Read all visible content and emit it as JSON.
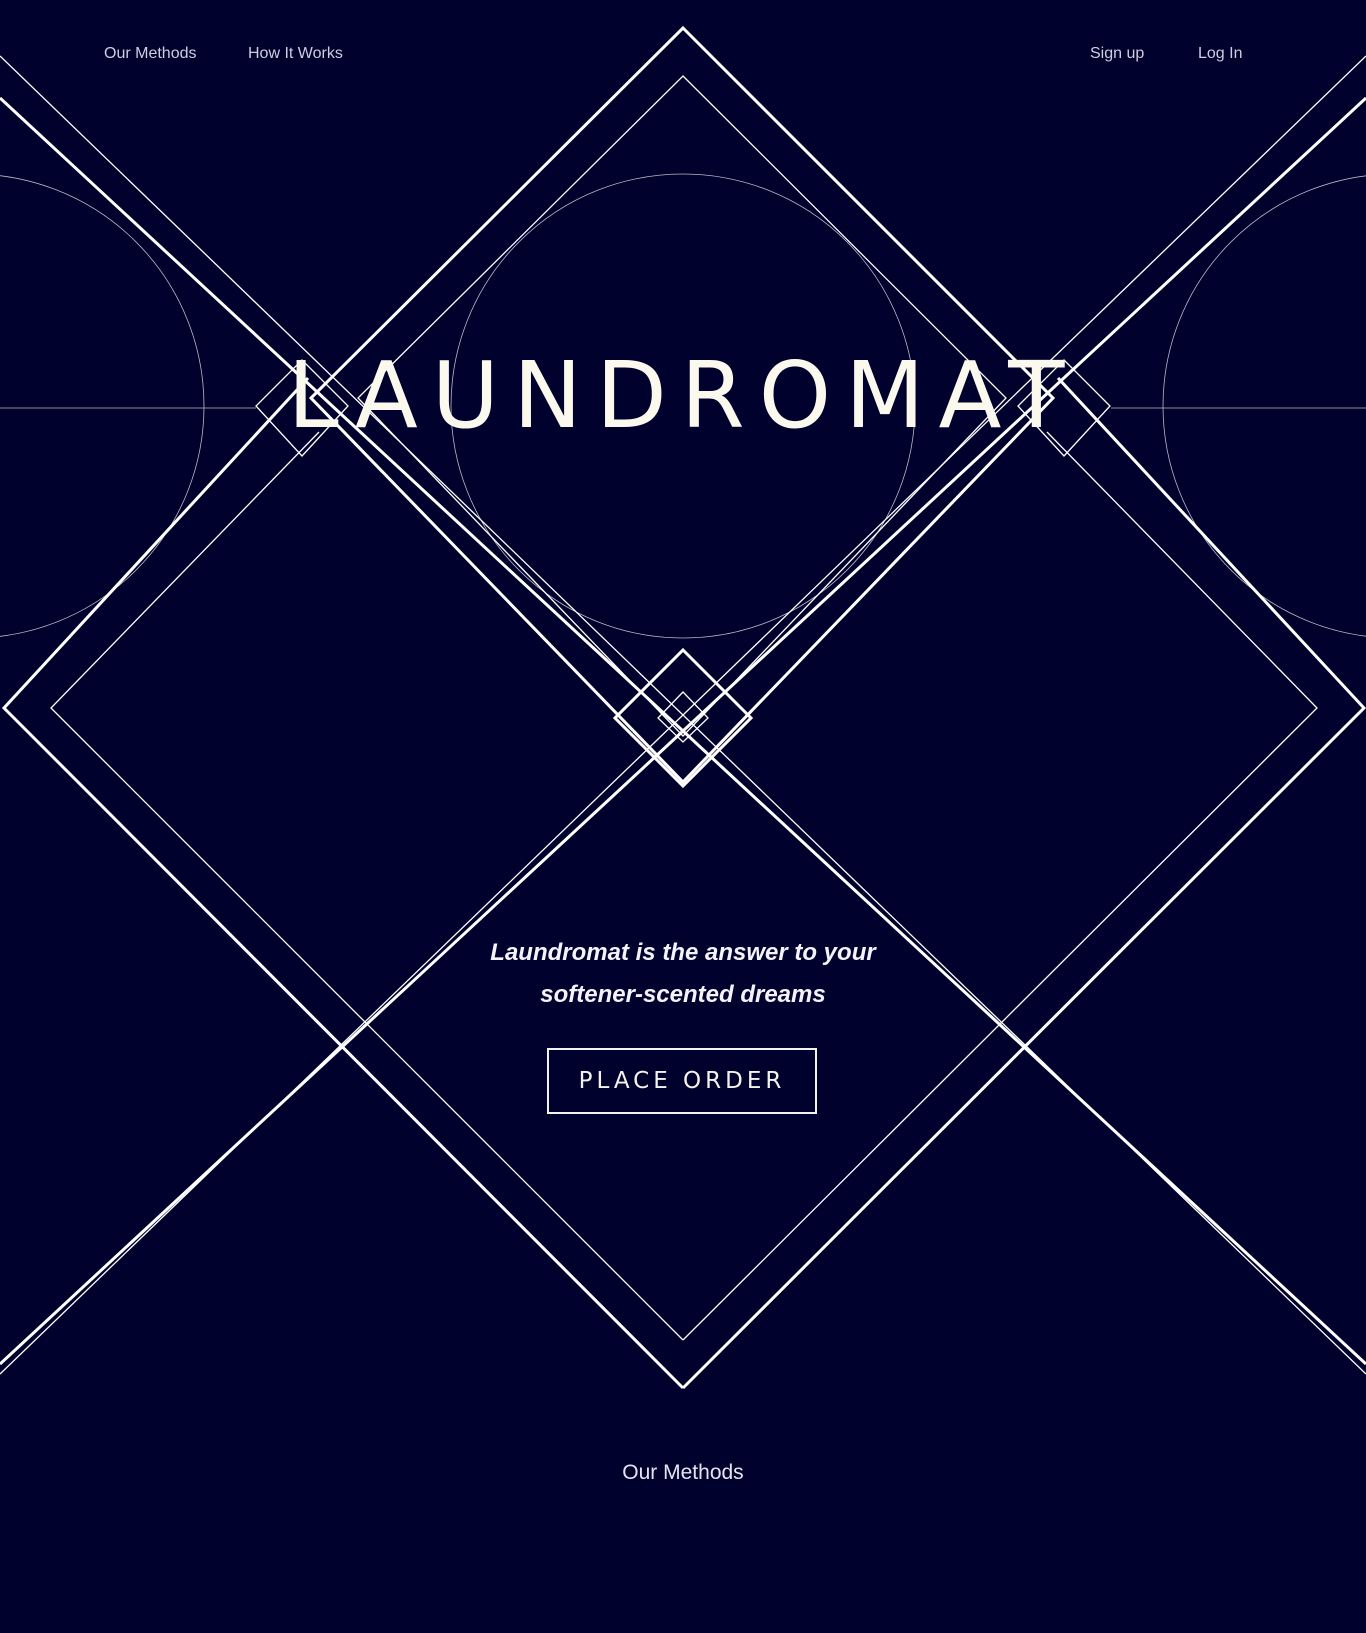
{
  "nav": {
    "left": [
      {
        "label": "Our Methods"
      },
      {
        "label": "How It Works"
      }
    ],
    "right": [
      {
        "label": "Sign up"
      },
      {
        "label": "Log In"
      }
    ]
  },
  "hero": {
    "logo_text": "LAUNDROMAT",
    "tagline_line1": "Laundromat is the answer to your",
    "tagline_line2": "softener-scented dreams",
    "cta_label": "PLACE ORDER"
  },
  "methods": {
    "heading": "Our Methods"
  },
  "colors": {
    "background": "#00012c",
    "line": "#ffffff",
    "text": "#f4f2ec"
  }
}
